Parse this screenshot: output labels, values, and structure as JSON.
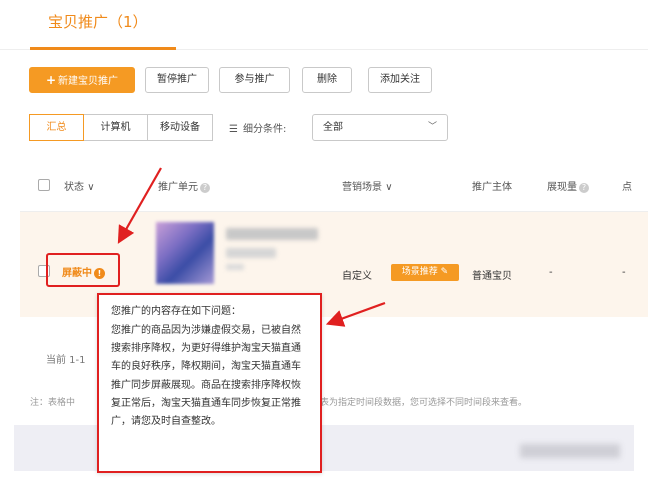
{
  "tabs": {
    "active_label": "宝贝推广（1）"
  },
  "toolbar": {
    "new_label": "新建宝贝推广",
    "pause_label": "暂停推广",
    "join_label": "参与推广",
    "delete_label": "删除",
    "follow_label": "添加关注"
  },
  "device_tabs": {
    "summary": "汇总",
    "computer": "计算机",
    "mobile": "移动设备"
  },
  "filter": {
    "label": "细分条件:",
    "selected": "全部"
  },
  "table": {
    "headers": {
      "status": "状态",
      "unit": "推广单元",
      "scene": "营销场景",
      "subject": "推广主体",
      "impressions": "展现量",
      "clicks": "点"
    },
    "row": {
      "status": "屏蔽中",
      "custom": "自定义",
      "scene_badge": "场景推荐",
      "subject": "普通宝贝",
      "impressions": "-",
      "clicks": "-"
    }
  },
  "pager": {
    "text": "当前 1-1"
  },
  "note": {
    "left": "注：表格中",
    "right": "表为指定时间段数据，您可选择不同时间段来查看。"
  },
  "tooltip": {
    "title": "您推广的内容存在如下问题：",
    "body": "您推广的商品因为涉嫌虚假交易，已被自然搜索排序降权，为更好得维护淘宝天猫直通车的良好秩序，降权期间，淘宝天猫直通车推广同步屏蔽展现。商品在搜索排序降权恢复正常后，淘宝天猫直通车同步恢复正常推广，请您及时自查整改。"
  },
  "colors": {
    "accent": "#f08a1a",
    "primary_button": "#f59a23",
    "annotation_red": "#e02020"
  }
}
